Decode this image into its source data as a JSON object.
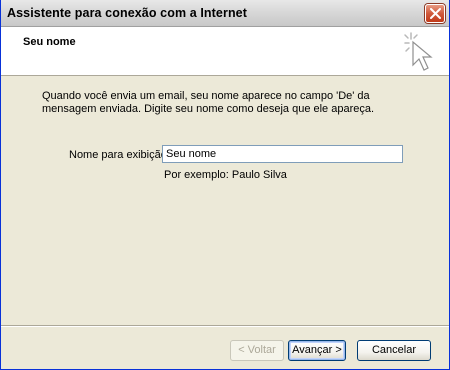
{
  "window": {
    "title": "Assistente para conexão com a Internet"
  },
  "header": {
    "heading": "Seu nome"
  },
  "content": {
    "description": "Quando você envia um email, seu nome aparece no campo 'De' da mensagem enviada. Digite seu nome como deseja que ele apareça.",
    "field_label": "Nome para exibição:",
    "field_value": "Seu nome",
    "example": "Por exemplo: Paulo Silva"
  },
  "buttons": {
    "back": "< Voltar",
    "next": "Avançar >",
    "cancel": "Cancelar"
  },
  "colors": {
    "titlebar": "#d8d8d8",
    "close_button": "#c13a1a",
    "dialog_bg": "#ece9d8",
    "header_bg": "#ffffff"
  },
  "icons": {
    "close": "close-icon",
    "wizard": "wizard-cursor-icon"
  }
}
